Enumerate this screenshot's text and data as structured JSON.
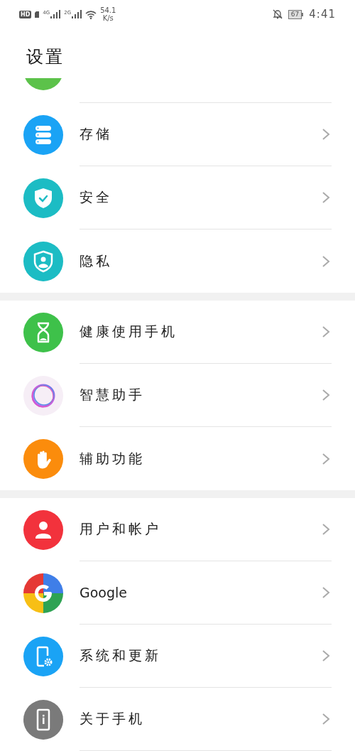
{
  "status_bar": {
    "hd": "HD",
    "networks": [
      {
        "label": "4G"
      },
      {
        "label": "2G"
      }
    ],
    "speed_value": "54.1",
    "speed_unit": "K/s",
    "battery": "67",
    "time": "4:41"
  },
  "title": "设置",
  "groups": [
    {
      "items": [
        {
          "label": "存储"
        },
        {
          "label": "安全"
        },
        {
          "label": "隐私"
        }
      ]
    },
    {
      "items": [
        {
          "label": "健康使用手机"
        },
        {
          "label": "智慧助手"
        },
        {
          "label": "辅助功能"
        }
      ]
    },
    {
      "items": [
        {
          "label": "用户和帐户"
        },
        {
          "label": "Google"
        },
        {
          "label": "系统和更新"
        },
        {
          "label": "关于手机"
        }
      ]
    }
  ]
}
